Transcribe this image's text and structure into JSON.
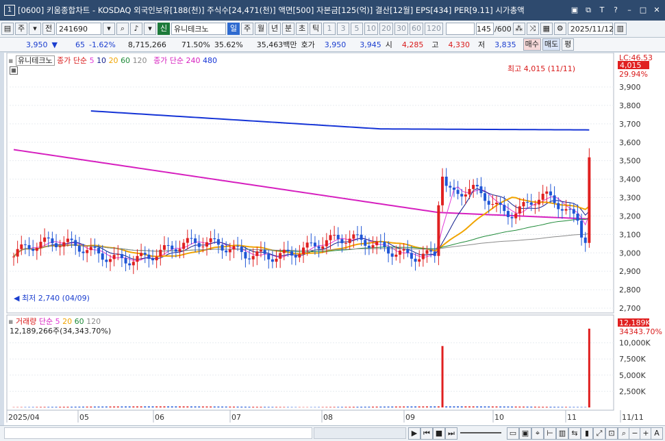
{
  "title": {
    "number": "1",
    "text": "[0600] 키움종합차트 - KOSDAQ 외국인보유[188(천)] 주식수[24,471(천)] 액면[500] 자본금[125(억)] 결산[12월] EPS[434] PER[9.11] 시가총액"
  },
  "toolbar": {
    "period": "주",
    "range": "전",
    "code": "241690",
    "market_badge": "신",
    "stock_name": "유니테크노",
    "units": [
      "일",
      "주",
      "월",
      "년",
      "분",
      "초",
      "틱"
    ],
    "active_unit": "일",
    "intervals": [
      "1",
      "3",
      "5",
      "10",
      "20",
      "30",
      "60",
      "120"
    ],
    "count": "145",
    "count_total": "/600",
    "date": "2025/11/12"
  },
  "quote": {
    "price": "3,950",
    "change": "65",
    "change_pct": "-1.62%",
    "volume": "8,715,266",
    "ratio1": "71.50%",
    "ratio2": "35.62%",
    "amount": "35,463백만",
    "hoga_label": "호가",
    "ask": "3,950",
    "bid": "3,945",
    "open_label": "시",
    "open": "4,285",
    "high_label": "고",
    "high": "4,330",
    "low_label": "저",
    "low": "3,835",
    "buy_label": "매수",
    "sell_label": "매도",
    "avg_label": "평"
  },
  "price_legend": {
    "stock": "유니테크노",
    "ma_label": "종가 단순",
    "ma": [
      "5",
      "10",
      "20",
      "60",
      "120"
    ],
    "ma_long_label": "종가 단순",
    "ma_long": [
      "240",
      "480"
    ]
  },
  "annotations": {
    "high": "최고 4,015 (11/11)",
    "low": "최저 2,740 (04/09)",
    "lc_tag": "LC:46.53",
    "last_price": "4,015",
    "last_pct": "29.94%"
  },
  "volume_legend": {
    "label": "거래량",
    "ma_label": "단순",
    "ma": [
      "5",
      "20",
      "60",
      "120"
    ],
    "value_text": "12,189,266주(34,343.70%)",
    "last_tag": "12,189K",
    "last_pct": "34343.70%"
  },
  "colors": {
    "up": "#e02020",
    "down": "#1f56d6",
    "ma5": "#e23ad6",
    "ma10": "#101d8c",
    "ma20": "#f0a400",
    "ma60": "#1e8a38",
    "ma120": "#8a8a8a",
    "ma240": "#d61fbf",
    "ma480": "#1433d6"
  },
  "chart_data": {
    "type": "candlestick",
    "y_axis_price": [
      "3,900",
      "3,800",
      "3,700",
      "3,600",
      "3,500",
      "3,400",
      "3,300",
      "3,200",
      "3,100",
      "3,000",
      "2,900",
      "2,800",
      "2,700"
    ],
    "y_axis_volume": [
      "10,000K",
      "7,500K",
      "5,000K",
      "2,500K"
    ],
    "x_axis": [
      "2025/04",
      "05",
      "06",
      "07",
      "08",
      "09",
      "10",
      "11",
      "11/11"
    ],
    "price_range": [
      2700,
      4015
    ],
    "high": {
      "value": 4015,
      "date": "11/11"
    },
    "low": {
      "value": 2740,
      "date": "04/09"
    }
  }
}
